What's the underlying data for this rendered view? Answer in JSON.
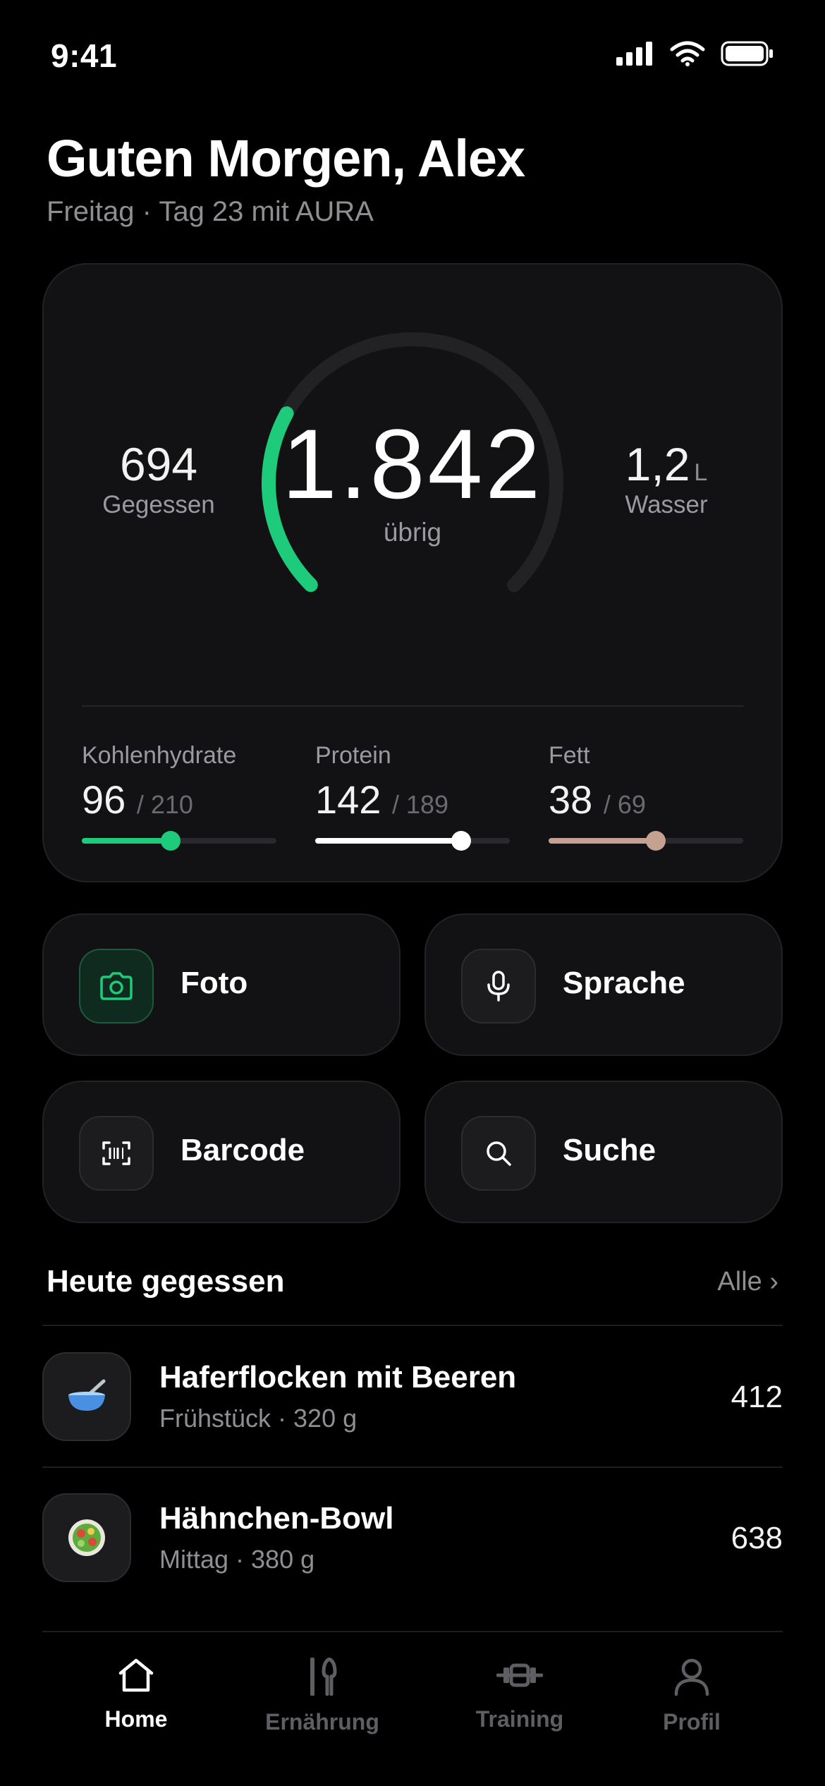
{
  "status_bar": {
    "time": "9:41"
  },
  "header": {
    "greeting": "Guten Morgen, Alex",
    "subline": "Freitag · Tag 23 mit AURA"
  },
  "summary": {
    "eaten_value": "694",
    "eaten_label": "Gegessen",
    "remaining_value": "1.842",
    "remaining_label": "übrig",
    "water_value": "1,2",
    "water_unit": "L",
    "water_label": "Wasser",
    "ring_progress": 0.274,
    "ring_color": "#1ecb7a"
  },
  "macros": [
    {
      "label": "Kohlenhydrate",
      "value": "96",
      "goal": "/ 210",
      "progress": 0.457,
      "color": "#1ecb7a"
    },
    {
      "label": "Protein",
      "value": "142",
      "goal": "/ 189",
      "progress": 0.751,
      "color": "#ffffff"
    },
    {
      "label": "Fett",
      "value": "38",
      "goal": "/ 69",
      "progress": 0.551,
      "color": "#c4a190"
    }
  ],
  "actions": [
    {
      "label": "Foto",
      "icon": "camera-icon"
    },
    {
      "label": "Sprache",
      "icon": "microphone-icon"
    },
    {
      "label": "Barcode",
      "icon": "barcode-icon"
    },
    {
      "label": "Suche",
      "icon": "search-icon"
    }
  ],
  "today": {
    "title": "Heute gegessen",
    "link": "Alle ›",
    "meals": [
      {
        "name": "Haferflocken mit Beeren",
        "meta": "Frühstück · 320 g",
        "kcal": "412",
        "icon": "bowl-icon"
      },
      {
        "name": "Hähnchen-Bowl",
        "meta": "Mittag · 380 g",
        "kcal": "638",
        "icon": "salad-icon"
      }
    ]
  },
  "tabs": [
    {
      "label": "Home",
      "icon": "home-icon",
      "active": true
    },
    {
      "label": "Ernährung",
      "icon": "cutlery-icon",
      "active": false
    },
    {
      "label": "Training",
      "icon": "dumbbell-icon",
      "active": false
    },
    {
      "label": "Profil",
      "icon": "person-icon",
      "active": false
    }
  ],
  "colors": {
    "accent": "#1ecb7a",
    "background": "#000000",
    "card": "#121214"
  }
}
